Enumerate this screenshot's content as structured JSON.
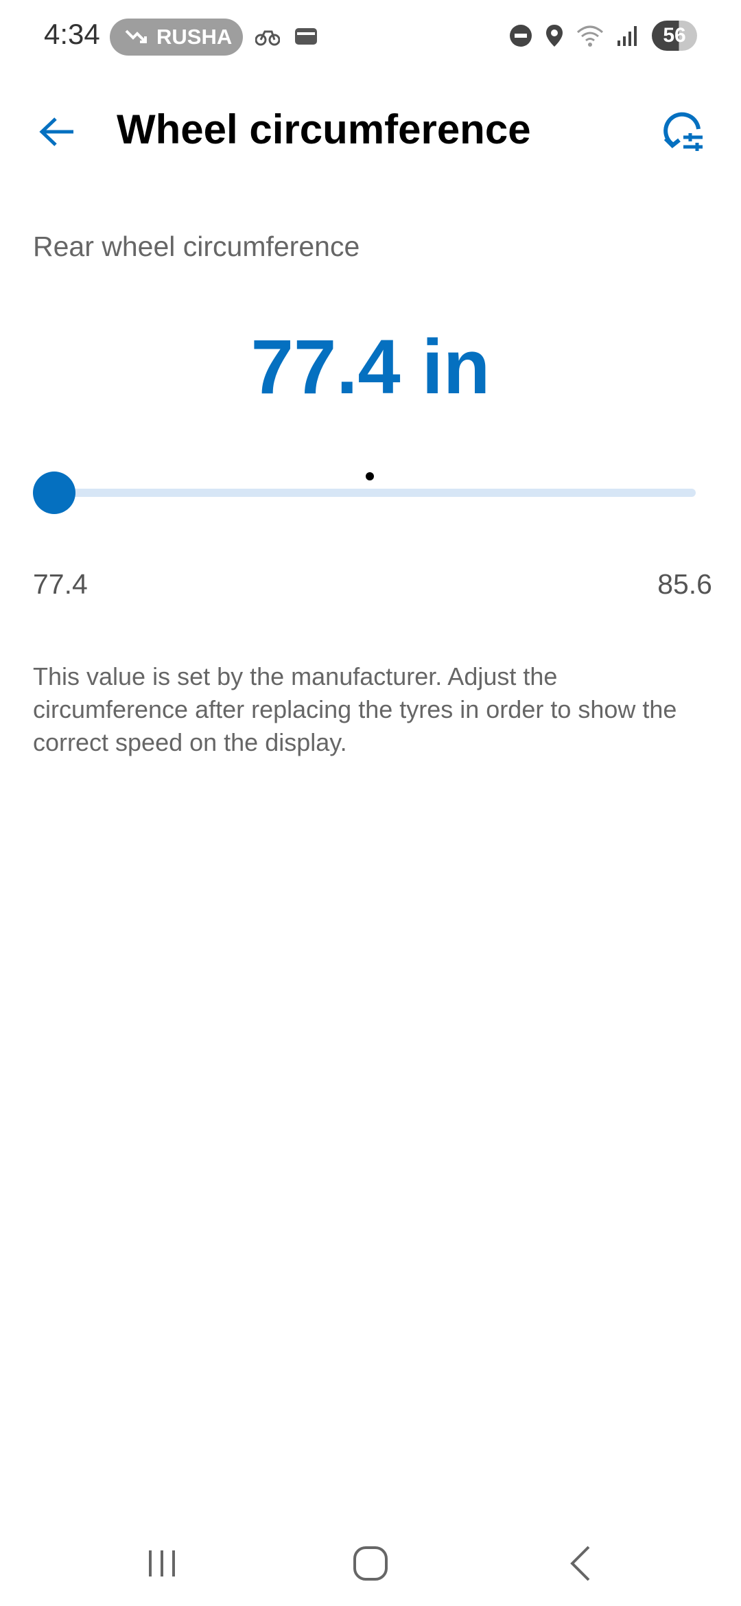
{
  "status_bar": {
    "time": "4:34",
    "activity_pill": "RUSHA",
    "battery": "56"
  },
  "header": {
    "title": "Wheel circumference",
    "back_icon": "arrow-left-icon",
    "reset_icon": "reset-settings-icon"
  },
  "main": {
    "section_label": "Rear wheel circumference",
    "current_value": "77.4 in",
    "slider": {
      "min_label": "77.4",
      "max_label": "85.6",
      "min": 77.4,
      "max": 85.6,
      "value": 77.4
    },
    "description": "This value is set by the manufacturer. Adjust the circumference after replacing the tyres in order to show the correct speed on the display."
  },
  "colors": {
    "accent": "#0570c0",
    "track": "#d7e6f6",
    "text_secondary": "#666666"
  },
  "nav_bar": {
    "recents_icon": "recents-icon",
    "home_icon": "home-icon",
    "back_icon": "back-chevron-icon"
  }
}
